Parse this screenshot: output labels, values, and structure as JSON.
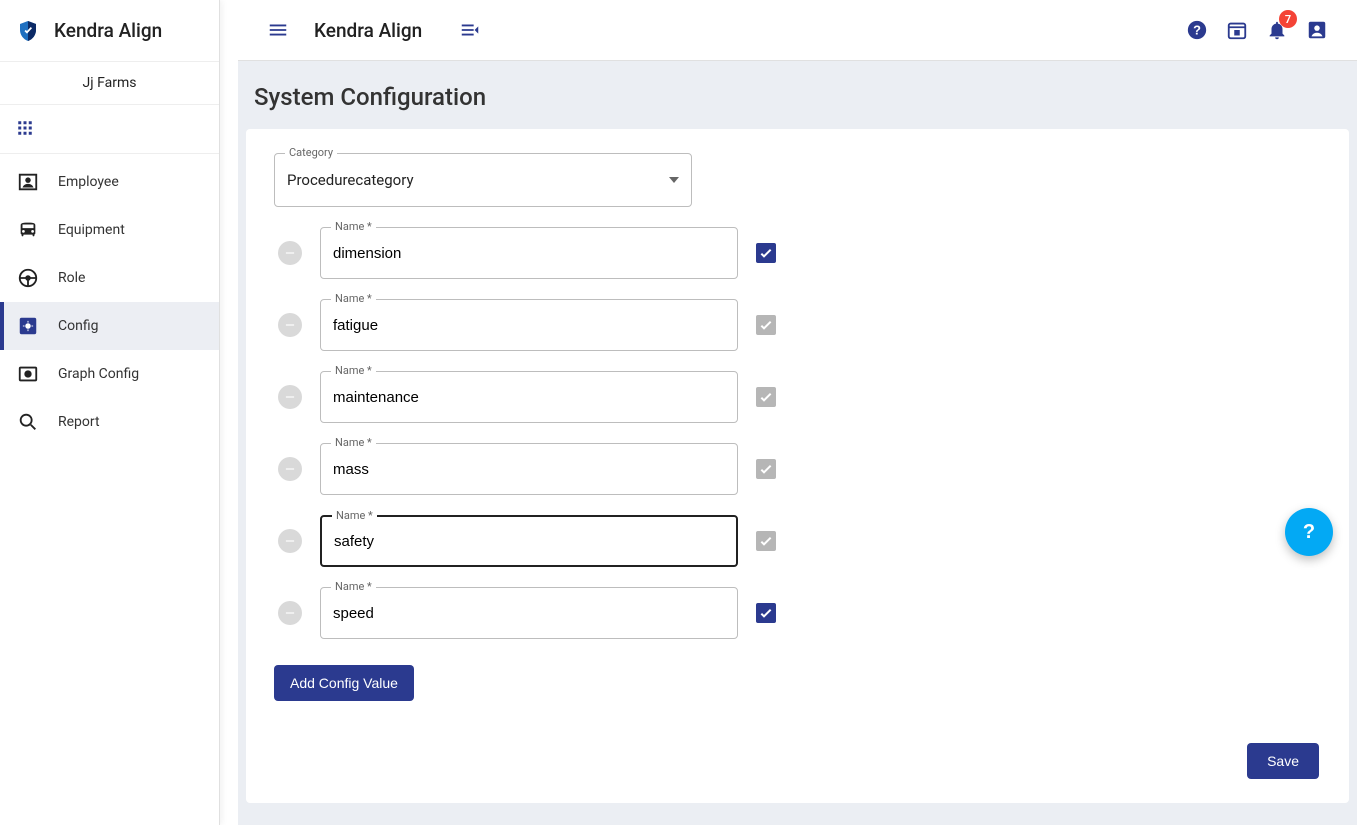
{
  "brand": {
    "title": "Kendra Align"
  },
  "farm": "Jj Farms",
  "sidebar": {
    "items": [
      {
        "label": "Employee"
      },
      {
        "label": "Equipment"
      },
      {
        "label": "Role"
      },
      {
        "label": "Config"
      },
      {
        "label": "Graph Config"
      },
      {
        "label": "Report"
      }
    ]
  },
  "topbar": {
    "title": "Kendra Align",
    "notifications": "7"
  },
  "page": {
    "title": "System Configuration",
    "category_label": "Category",
    "category_value": "Procedurecategory",
    "name_label": "Name *",
    "add_button": "Add Config Value",
    "save_button": "Save",
    "rows": [
      {
        "value": "dimension",
        "checked": true,
        "focused": false
      },
      {
        "value": "fatigue",
        "checked": false,
        "focused": false
      },
      {
        "value": "maintenance",
        "checked": false,
        "focused": false
      },
      {
        "value": "mass",
        "checked": false,
        "focused": false
      },
      {
        "value": "safety",
        "checked": false,
        "focused": true
      },
      {
        "value": "speed",
        "checked": true,
        "focused": false
      }
    ]
  },
  "fab": "?"
}
